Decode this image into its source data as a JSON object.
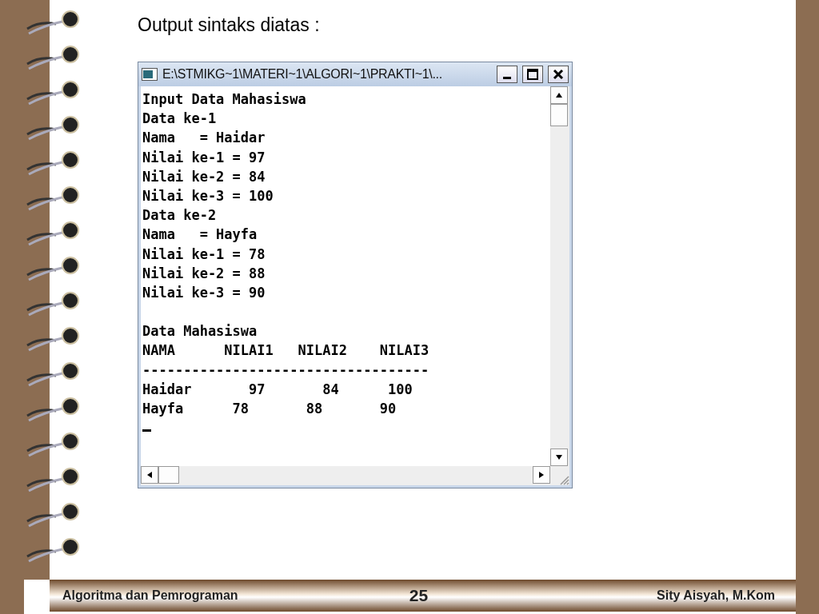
{
  "slide": {
    "heading": "Output sintaks diatas :"
  },
  "console": {
    "title": "E:\\STMIKG~1\\MATERI~1\\ALGORI~1\\PRAKTI~1\\...",
    "blocks": [
      [
        "Input Data Mahasiswa",
        "Data ke-1",
        "Nama   = Haidar",
        "Nilai ke-1 = 97",
        "Nilai ke-2 = 84",
        "Nilai ke-3 = 100",
        "Data ke-2",
        "Nama   = Hayfa",
        "Nilai ke-1 = 78",
        "Nilai ke-2 = 88",
        "Nilai ke-3 = 90"
      ],
      [
        "Data Mahasiswa",
        "NAMA      NILAI1   NILAI2    NILAI3",
        "-----------------------------------",
        "Haidar       97       84      100",
        "Hayfa      78       88       90"
      ]
    ]
  },
  "footer": {
    "left": "Algoritma dan Pemrograman",
    "page": "25",
    "right": "Sity Aisyah, M.Kom"
  }
}
